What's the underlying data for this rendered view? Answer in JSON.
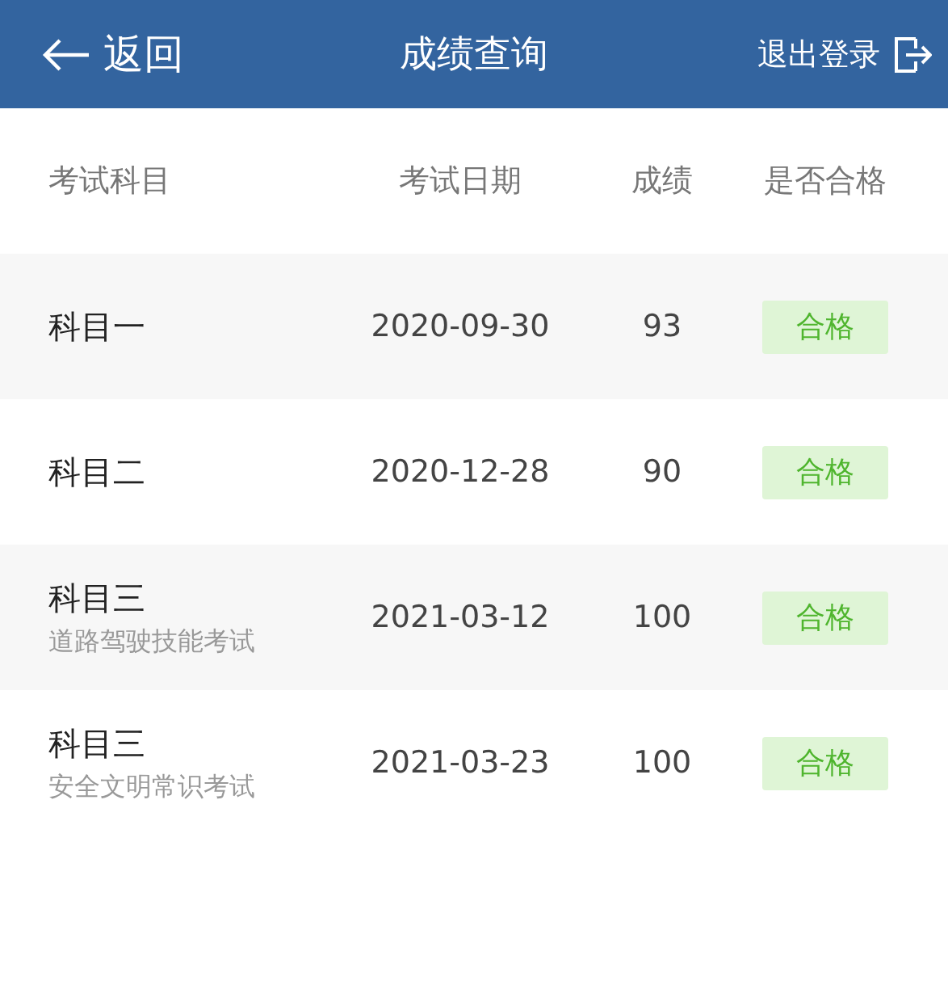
{
  "header": {
    "back": "返回",
    "title": "成绩查询",
    "logout": "退出登录"
  },
  "columns": [
    "考试科目",
    "考试日期",
    "成绩",
    "是否合格"
  ],
  "rows": [
    {
      "subject": "科目一",
      "date": "2020-09-30",
      "score": "93",
      "result": "合格",
      "passed": true
    },
    {
      "subject": "科目二",
      "date": "2020-12-28",
      "score": "90",
      "result": "合格",
      "passed": true
    },
    {
      "subject": "科目三",
      "note": "道路驾驶技能考试",
      "date": "2021-03-12",
      "score": "100",
      "result": "合格",
      "passed": true
    },
    {
      "subject": "科目三",
      "note": "安全文明常识考试",
      "date": "2021-03-23",
      "score": "100",
      "result": "合格",
      "passed": true
    }
  ]
}
